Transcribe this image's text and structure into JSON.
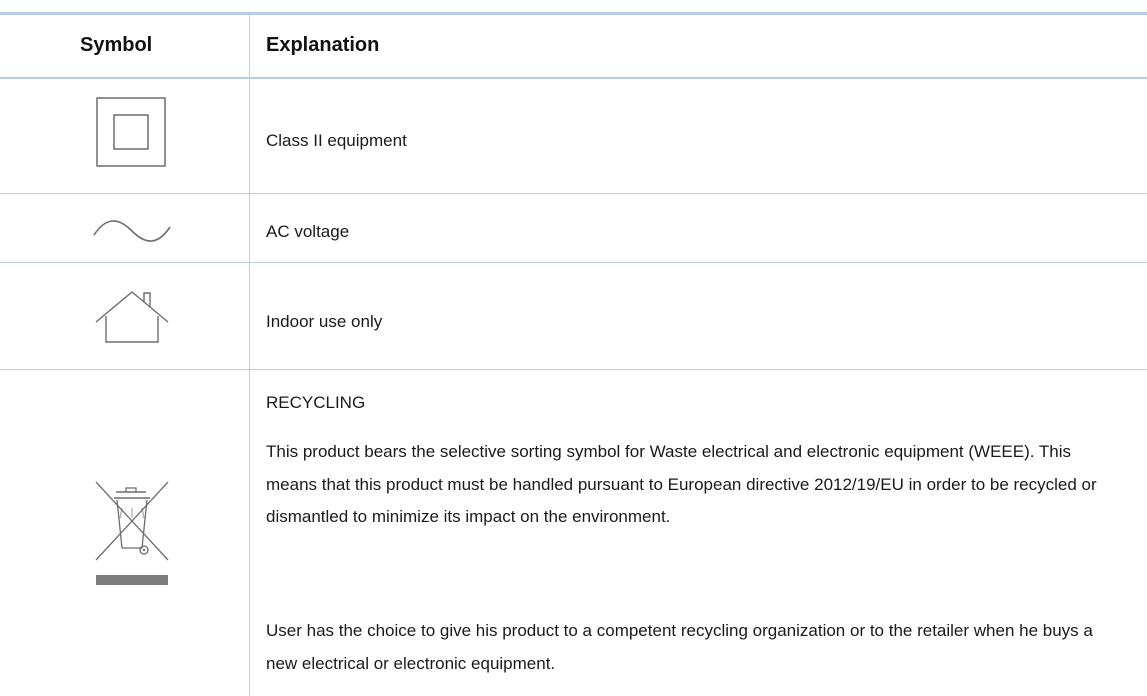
{
  "table": {
    "header": {
      "symbol": "Symbol",
      "explanation": "Explanation"
    },
    "rows": [
      {
        "icon": "class-ii-double-square-icon",
        "text": "Class II equipment"
      },
      {
        "icon": "ac-sine-wave-icon",
        "text": "AC voltage"
      },
      {
        "icon": "indoor-house-icon",
        "text": "Indoor use only"
      },
      {
        "icon": "weee-crossed-bin-icon",
        "title": "RECYCLING",
        "para1": "This product bears the selective sorting symbol for Waste electrical and electronic equipment (WEEE). This means that this product must be handled pursuant to European directive 2012/19/EU in order to be recycled or dismantled to minimize its impact on the environment.",
        "para2": "User has the choice to give his product to a competent recycling organization or to the retailer when he buys a new electrical or electronic equipment."
      }
    ]
  },
  "colors": {
    "rule": "#b5cde6",
    "icon": "#6d6d6d",
    "text": "#1a1a1a"
  }
}
